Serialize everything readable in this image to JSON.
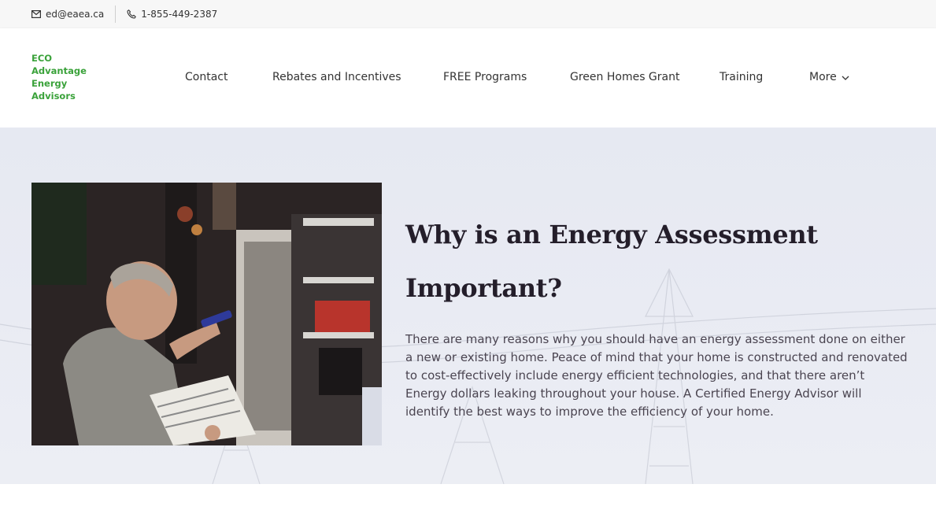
{
  "topbar": {
    "email": "ed@eaea.ca",
    "phone": "1-855-449-2387"
  },
  "logo": {
    "lines": [
      "ECO",
      "Advantage",
      "Energy",
      "Advisors"
    ],
    "color": "#3aa23a"
  },
  "nav": {
    "items": [
      "Contact",
      "Rebates and Incentives",
      "FREE Programs",
      "Green Homes Grant",
      "Training",
      "More"
    ]
  },
  "hero": {
    "title": "Why is an Energy Assessment Important?",
    "body": "There are many reasons why you should have an energy assessment done on either a new or existing home. Peace of mind that your home is constructed and renovated to cost-effectively include energy efficient technologies, and that there aren’t Energy dollars leaking throughout your house. A Certified Energy Advisor will identify the best ways to improve the efficiency of your home.",
    "photo_alt": "Energy advisor inspecting a furnace"
  }
}
